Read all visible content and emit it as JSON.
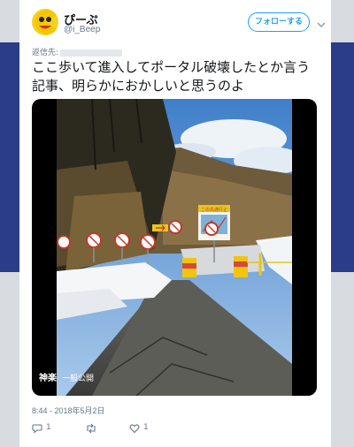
{
  "user": {
    "display_name": "ぴーぷ",
    "handle": "@i_Beep"
  },
  "follow_button": {
    "label": "フォローする"
  },
  "reply_to": {
    "label": "返信先:"
  },
  "tweet": {
    "text": "ここ歩いて進入してポータル破壊したとか言う記事、明らかにおかしいと思うのよ"
  },
  "media": {
    "location": "神楽",
    "visibility": "一般公開",
    "sign_title": "この先通行止"
  },
  "meta": {
    "timestamp": "8:44 - 2018年5月2日"
  },
  "actions": {
    "reply_count": "1",
    "retweet_count": "",
    "like_count": "1"
  },
  "colors": {
    "accent": "#1da1f2",
    "muted": "#657786",
    "page_bg": "#dfe2e6",
    "header_blue": "#2a3d86"
  }
}
